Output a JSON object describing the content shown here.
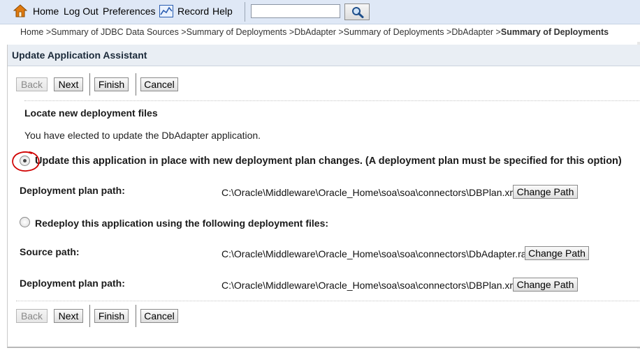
{
  "topbar": {
    "home": "Home",
    "logout": "Log Out",
    "preferences": "Preferences",
    "record": "Record",
    "help": "Help",
    "search_value": ""
  },
  "breadcrumb": {
    "items": [
      "Home >",
      "Summary of JDBC Data Sources >",
      "Summary of Deployments >",
      "DbAdapter >",
      "Summary of Deployments >",
      "DbAdapter >"
    ],
    "current": "Summary of Deployments"
  },
  "panel": {
    "title": "Update Application Assistant",
    "buttons": {
      "back": "Back",
      "next": "Next",
      "finish": "Finish",
      "cancel": "Cancel"
    },
    "section_title": "Locate new deployment files",
    "intro": "You have elected to update the DbAdapter application.",
    "option1": {
      "label": "Update this application in place with new deployment plan changes. (A deployment plan must be specified for this option)",
      "selected": true,
      "plan_label": "Deployment plan path:",
      "plan_path": "C:\\Oracle\\Middleware\\Oracle_Home\\soa\\soa\\connectors\\DBPlan.xml",
      "change_path": "Change Path"
    },
    "option2": {
      "label": "Redeploy this application using the following deployment files:",
      "selected": false,
      "source_label": "Source path:",
      "source_path": "C:\\Oracle\\Middleware\\Oracle_Home\\soa\\soa\\connectors\\DbAdapter.rar",
      "plan_label": "Deployment plan path:",
      "plan_path": "C:\\Oracle\\Middleware\\Oracle_Home\\soa\\soa\\connectors\\DBPlan.xml",
      "change_path": "Change Path"
    }
  },
  "colors": {
    "topbar_bg": "#dfe8f6",
    "header_bg": "#e9eef4",
    "annotation": "#d00000"
  },
  "icons": [
    "home-icon",
    "record-icon",
    "search-icon"
  ]
}
